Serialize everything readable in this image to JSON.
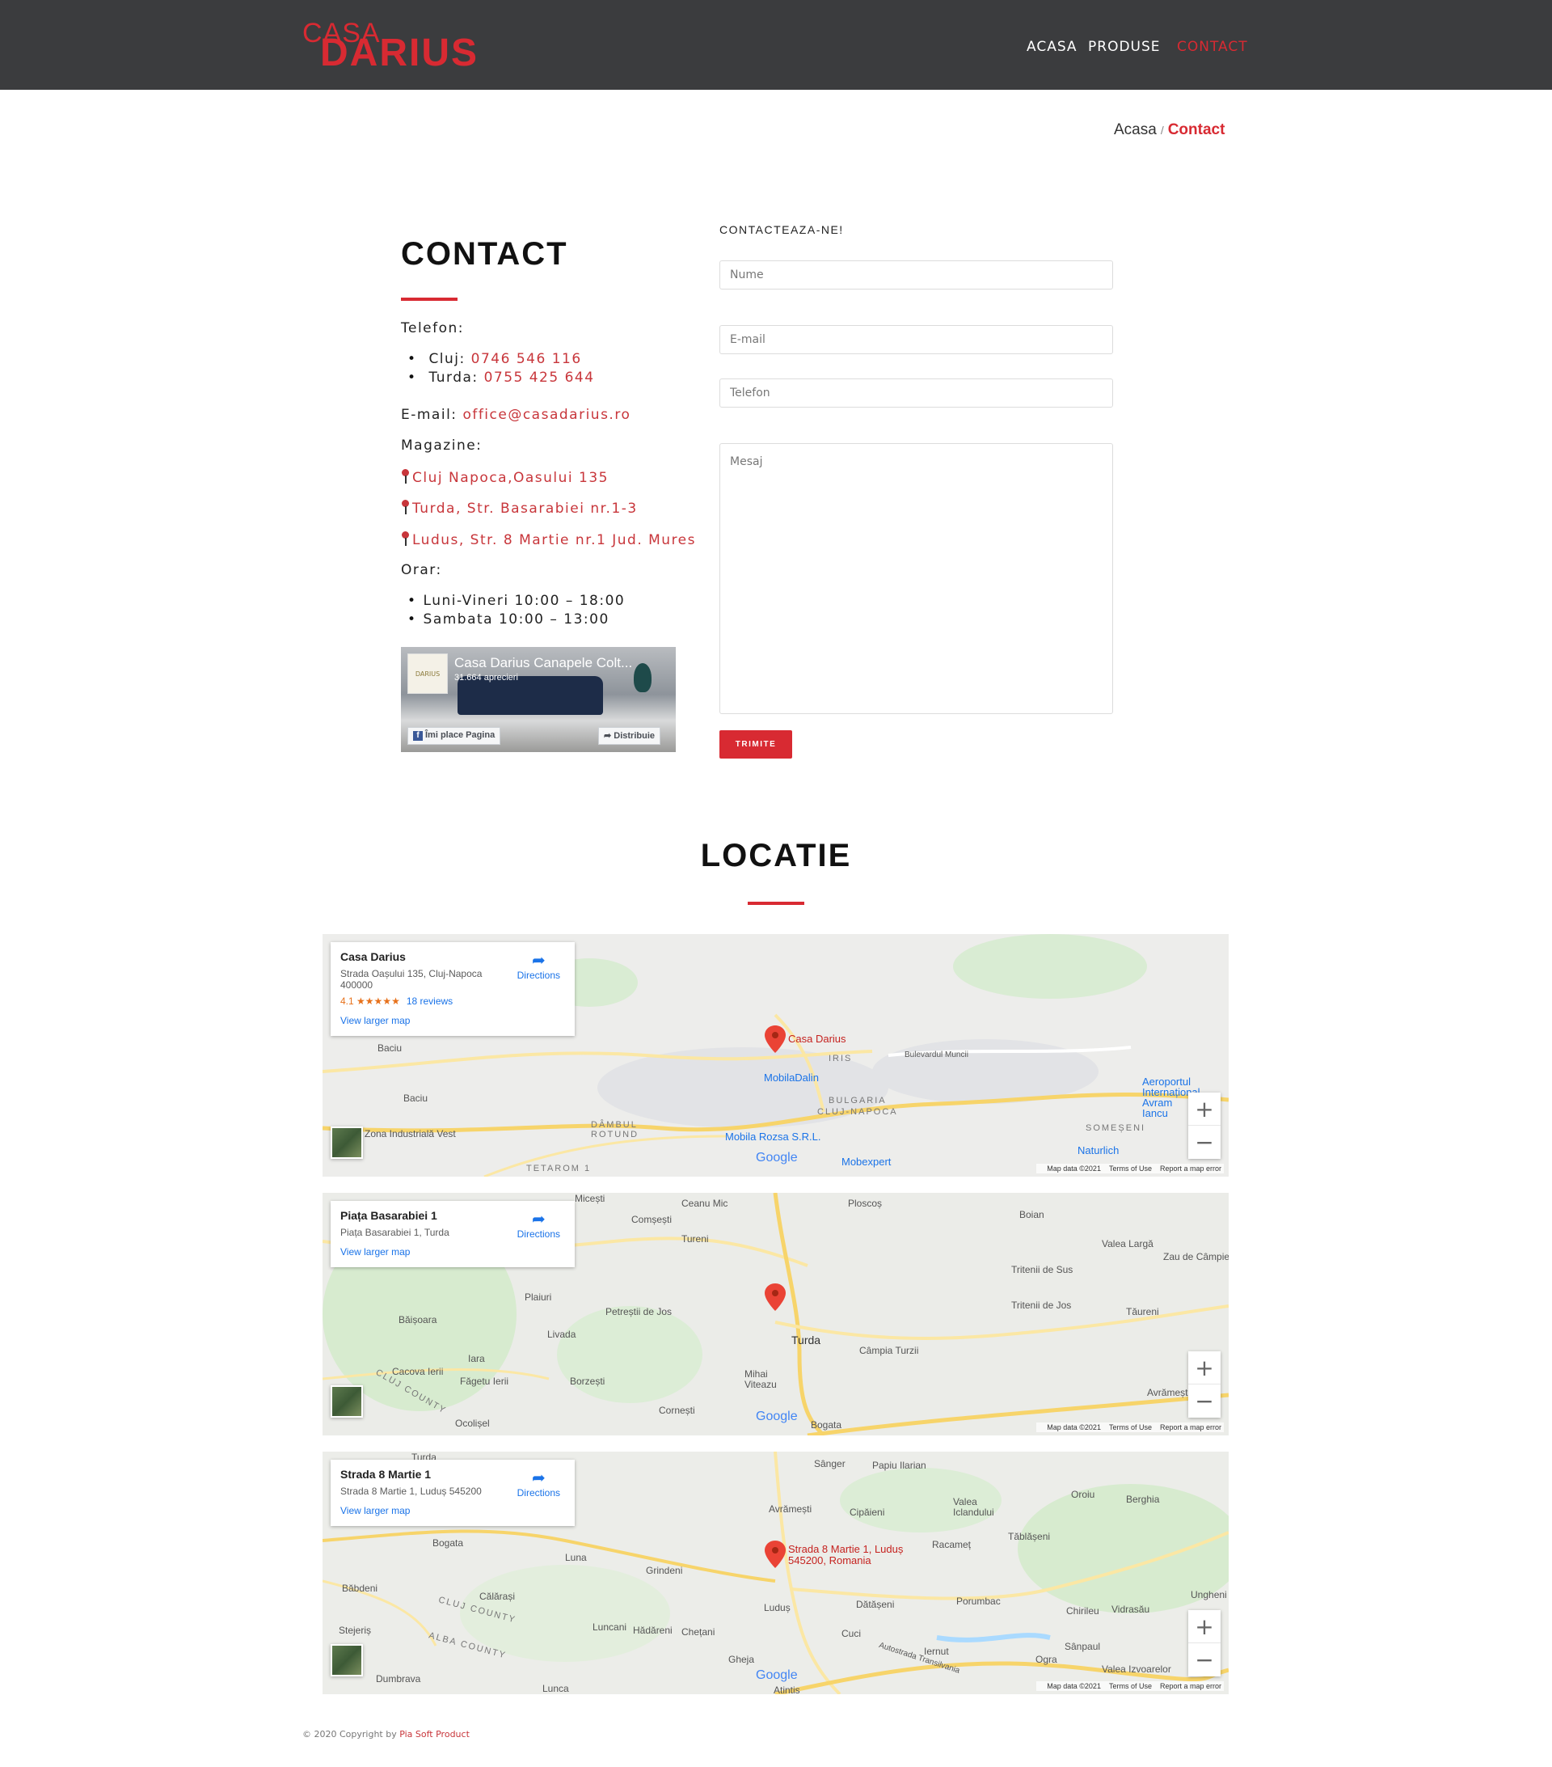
{
  "header": {
    "logo_top": "CASA",
    "logo_bottom": "DARIUS",
    "nav": [
      "ACASA",
      "PRODUSE",
      "CONTACT"
    ]
  },
  "breadcrumb": {
    "home": "Acasa",
    "sep": "/",
    "current": "Contact"
  },
  "contact": {
    "title": "CONTACT",
    "phone_label": "Telefon:",
    "phones": [
      {
        "city": "Cluj:",
        "number": "0746 546 116"
      },
      {
        "city": "Turda:",
        "number": "0755 425 644"
      }
    ],
    "email_label": "E-mail:",
    "email": "office@casadarius.ro",
    "stores_label": "Magazine:",
    "stores": [
      "Cluj Napoca,Oasului 135",
      "Turda, Str. Basarabiei nr.1-3",
      "Ludus, Str. 8 Martie nr.1 Jud. Mures"
    ],
    "hours_label": "Orar:",
    "hours": [
      "Luni-Vineri 10:00 – 18:00",
      "Sambata 10:00 – 13:00"
    ]
  },
  "facebook": {
    "page_name": "Casa Darius Canapele Colt...",
    "likes": "31.664 aprecieri",
    "thumb_text": "DARIUS",
    "like_button": "Îmi place Pagina",
    "share_button": "Distribuie"
  },
  "form": {
    "title": "CONTACTEAZA-NE!",
    "name_placeholder": "Nume",
    "email_placeholder": "E-mail",
    "phone_placeholder": "Telefon",
    "message_placeholder": "Mesaj",
    "submit": "TRIMITE"
  },
  "location": {
    "title": "LOCATIE"
  },
  "maps": [
    {
      "name": "Casa Darius",
      "address": "Strada Oașului 135, Cluj-Napoca 400000",
      "rating": "4.1",
      "stars": "★★★★★",
      "reviews": "18 reviews",
      "directions": "Directions",
      "larger": "View larger map",
      "pin_label": "Casa Darius",
      "labels": [
        "Baciu",
        "Baciu",
        "IRIS",
        "Bulevardul Muncii",
        "MobilaDalin",
        "BULGARIA",
        "CLUJ-NAPOCA",
        "DÂMBUL ROTUND",
        "Mobila Rozsa S.R.L.",
        "Mobexpert",
        "Naturlich",
        "SOMEȘENI",
        "Aeroportul Internațional Avram Iancu",
        "Zona Industrială Vest",
        "TETAROM 1"
      ]
    },
    {
      "name": "Piața Basarabiei 1",
      "address": "Piața Basarabiei 1, Turda",
      "directions": "Directions",
      "larger": "View larger map",
      "labels": [
        "Micești",
        "Ceanu Mic",
        "Comșești",
        "Tureni",
        "Ploscoș",
        "Boian",
        "Valea Largă",
        "Zau de Câmpie",
        "Tritenii de Sus",
        "Tritenii de Jos",
        "Plaiuri",
        "Petreștii de Jos",
        "Turda",
        "Câmpia Turzii",
        "Băișoara",
        "Livada",
        "Iara",
        "Mihai Viteazu",
        "Cacova Ierii",
        "Făgetu Ierii",
        "Borzești",
        "Cornești",
        "Bogata",
        "Tăureni",
        "Avrămești",
        "Ocolișel",
        "CLUJ COUNTY"
      ]
    },
    {
      "name": "Strada 8 Martie 1",
      "address": "Strada 8 Martie 1, Luduș 545200",
      "directions": "Directions",
      "larger": "View larger map",
      "pin_label": "Strada 8 Martie 1, Luduș 545200, Romania",
      "labels": [
        "Turda",
        "Sânger",
        "Papiu Ilarian",
        "Avrămești",
        "Cipăieni",
        "Valea Iclandului",
        "Oroiu",
        "Berghia",
        "Bogata",
        "Luna",
        "Grindeni",
        "Tăblășeni",
        "Racameț",
        "Băbdeni",
        "Călărași",
        "Luduș",
        "Porumbac",
        "Ungheni",
        "Chirileu",
        "Vidrasău",
        "Stejeriș",
        "Luncani",
        "Hădăreni",
        "Chețani",
        "Cuci",
        "Iernut",
        "Sânpaul",
        "Ogra",
        "Gheja",
        "Dumbrava",
        "Lunca",
        "Atintis",
        "Valea Izvoarelor",
        "ALBA COUNTY",
        "CLUJ COUNTY",
        "Autostrada Transilvania",
        "Dătășeni"
      ]
    }
  ],
  "map_common": {
    "map_data": "Map data ©2021",
    "terms": "Terms of Use",
    "report": "Report a map error",
    "google": "Google"
  },
  "footer": {
    "text": "© 2020 Copyright by ",
    "link": "Pia Soft Product"
  },
  "colors": {
    "accent": "#d82a32",
    "header_bg": "#3b3c3e",
    "link_blue": "#1a73e8"
  }
}
